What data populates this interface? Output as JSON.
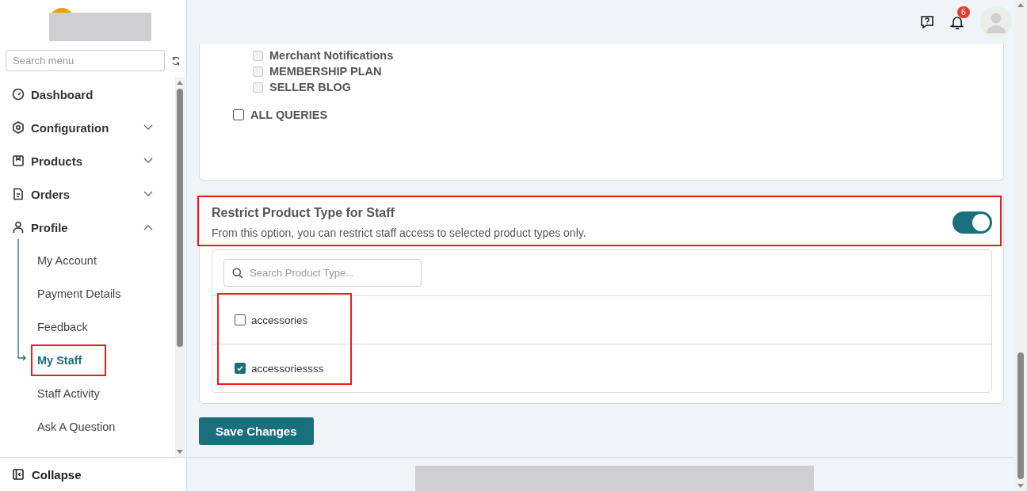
{
  "sidebar": {
    "search": {
      "placeholder": "Search menu"
    },
    "items": [
      {
        "label": "Dashboard"
      },
      {
        "label": "Configuration",
        "expanded": false
      },
      {
        "label": "Products",
        "expanded": false
      },
      {
        "label": "Orders",
        "expanded": false
      },
      {
        "label": "Profile",
        "expanded": true,
        "children": [
          {
            "label": "My Account",
            "selected": false,
            "highlighted": false
          },
          {
            "label": "Payment Details",
            "selected": false,
            "highlighted": false
          },
          {
            "label": "Feedback",
            "selected": false,
            "highlighted": false
          },
          {
            "label": "My Staff",
            "selected": true,
            "highlighted": true
          },
          {
            "label": "Staff Activity",
            "selected": false,
            "highlighted": false
          },
          {
            "label": "Ask A Question",
            "selected": false,
            "highlighted": false
          }
        ]
      }
    ],
    "collapse": {
      "label": "Collapse"
    }
  },
  "header": {
    "notification_count": "6"
  },
  "permissions": {
    "items": [
      {
        "label": "Merchant Notifications",
        "checked": false,
        "disabled": true
      },
      {
        "label": "MEMBERSHIP PLAN",
        "checked": false,
        "disabled": true
      },
      {
        "label": "SELLER BLOG",
        "checked": false,
        "disabled": true
      }
    ],
    "all_queries": {
      "label": "ALL QUERIES",
      "checked": false
    }
  },
  "restrict": {
    "title": "Restrict Product Type for Staff",
    "description": "From this option, you can restrict staff access to selected product types only.",
    "on": true,
    "highlighted": true,
    "search": {
      "placeholder": "Search Product Type..."
    },
    "list_highlighted": true,
    "product_types": [
      {
        "label": "accessories",
        "checked": false
      },
      {
        "label": "accessoriessss",
        "checked": true
      }
    ]
  },
  "save_button": {
    "label": "Save Changes"
  }
}
